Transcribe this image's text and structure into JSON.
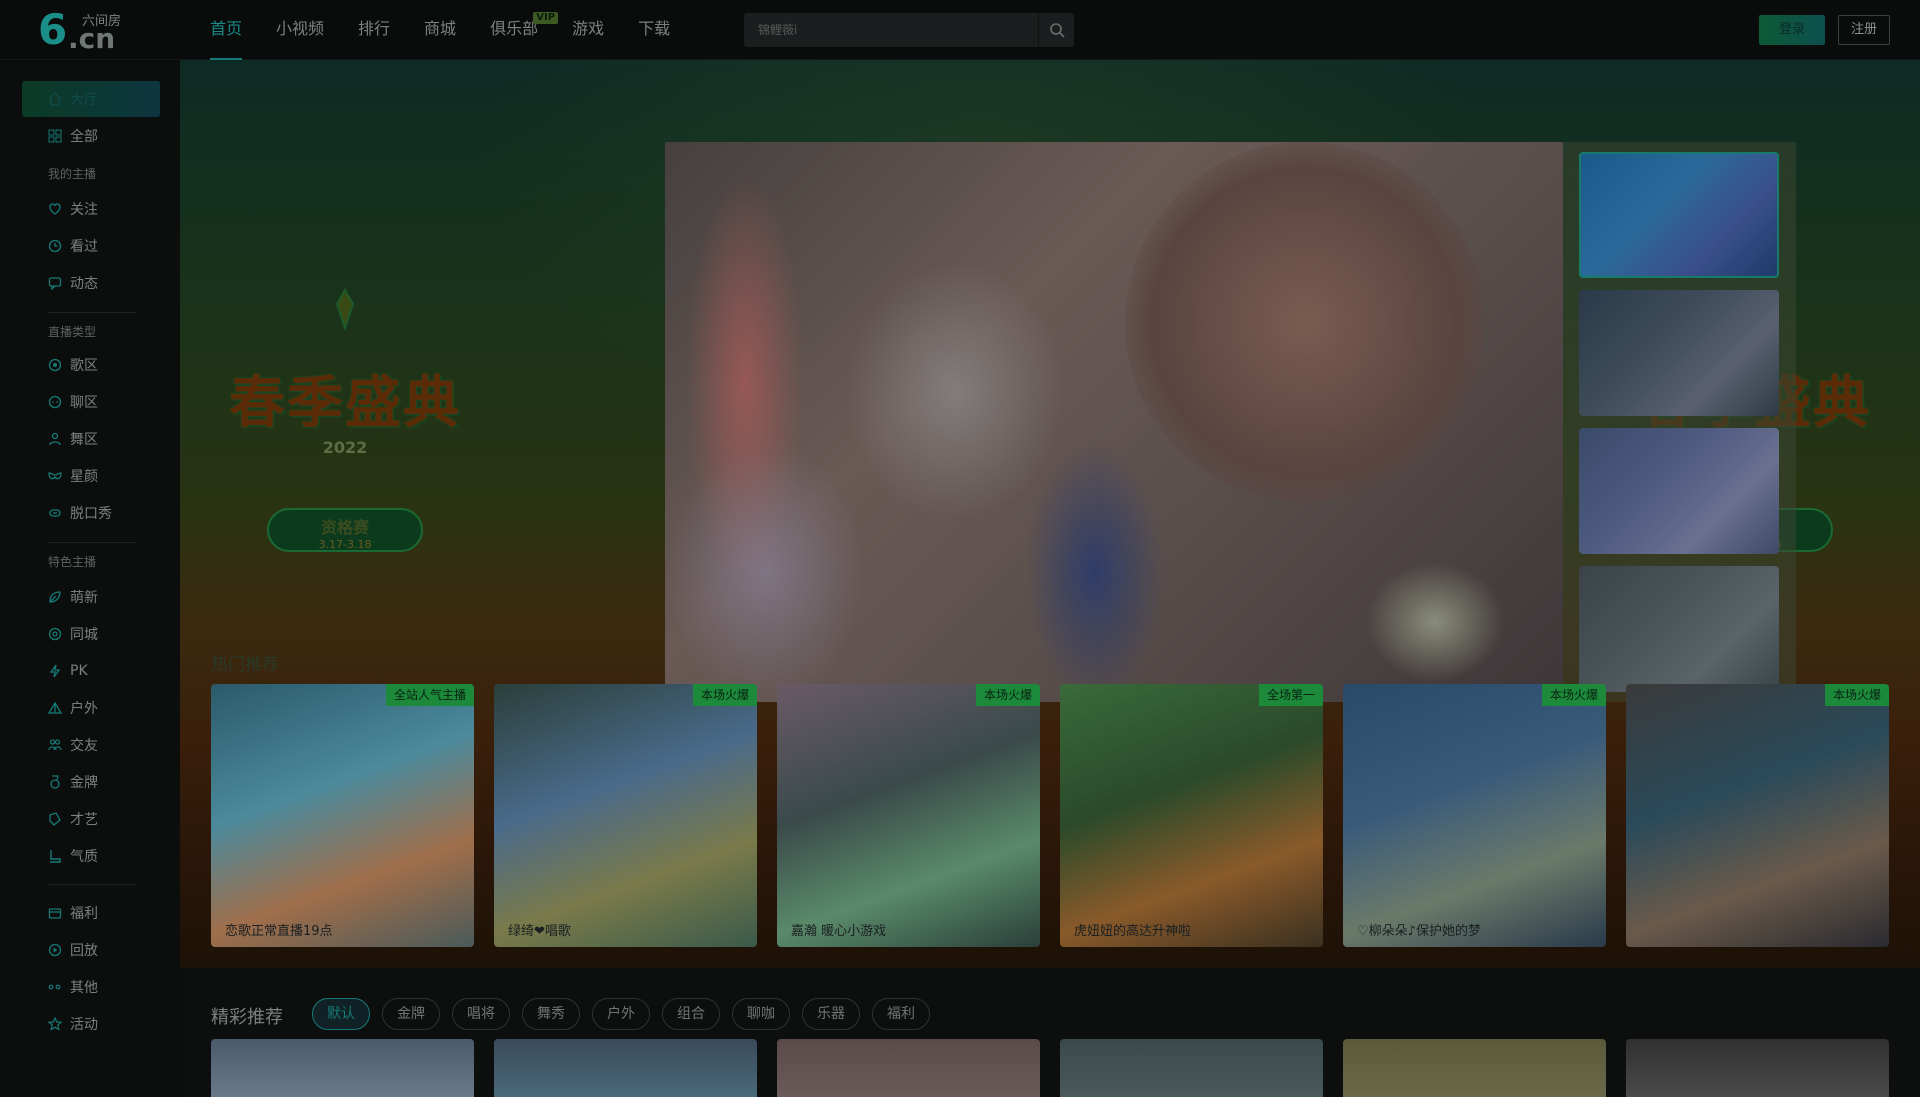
{
  "logo": {
    "mark": "6",
    "site_name": "六间房",
    "suffix": ".cn"
  },
  "nav": {
    "items": [
      {
        "label": "首页"
      },
      {
        "label": "小视频"
      },
      {
        "label": "排行"
      },
      {
        "label": "商城"
      },
      {
        "label": "俱乐部",
        "badge": "VIP"
      },
      {
        "label": "游戏"
      },
      {
        "label": "下载"
      }
    ],
    "active_index": 0
  },
  "search": {
    "placeholder": "锦鲤薇i"
  },
  "auth": {
    "login_label": "登录",
    "register_label": "注册"
  },
  "sidebar": {
    "main": [
      {
        "label": "大厅",
        "icon": "home-icon"
      },
      {
        "label": "全部",
        "icon": "grid-icon"
      }
    ],
    "group_my": "我的主播",
    "my": [
      {
        "label": "关注",
        "icon": "heart-icon"
      },
      {
        "label": "看过",
        "icon": "clock-icon"
      },
      {
        "label": "动态",
        "icon": "message-icon"
      }
    ],
    "group_type": "直播类型",
    "types": [
      {
        "label": "歌区",
        "icon": "music-icon"
      },
      {
        "label": "聊区",
        "icon": "chat-icon"
      },
      {
        "label": "舞区",
        "icon": "dance-icon"
      },
      {
        "label": "星颜",
        "icon": "mask-icon"
      },
      {
        "label": "脱口秀",
        "icon": "mic-icon"
      }
    ],
    "group_feature": "特色主播",
    "features": [
      {
        "label": "萌新",
        "icon": "leaf-icon"
      },
      {
        "label": "同城",
        "icon": "location-icon"
      },
      {
        "label": "PK",
        "icon": "bolt-icon"
      },
      {
        "label": "户外",
        "icon": "mountain-icon"
      },
      {
        "label": "交友",
        "icon": "people-icon"
      },
      {
        "label": "金牌",
        "icon": "medal-icon"
      },
      {
        "label": "才艺",
        "icon": "palette-icon"
      },
      {
        "label": "气质",
        "icon": "boot-icon"
      }
    ],
    "extras": [
      {
        "label": "福利",
        "icon": "gift-icon"
      },
      {
        "label": "回放",
        "icon": "replay-icon"
      },
      {
        "label": "其他",
        "icon": "dots-icon"
      },
      {
        "label": "活动",
        "icon": "star-icon"
      }
    ]
  },
  "event": {
    "title": "春季盛典",
    "year": "2022",
    "round": "资格赛",
    "dates": "3.17-3.18"
  },
  "hot_label": "热门推荐",
  "hot_cards": [
    {
      "tag": "全站人气主播",
      "caption": "恋歌正常直播19点"
    },
    {
      "tag": "本场火爆",
      "caption": "绿绮❤唱歌"
    },
    {
      "tag": "本场火爆",
      "caption": "嘉瀚 暖心小游戏"
    },
    {
      "tag": "全场第一",
      "caption": "虎妞妞的高达升神啦"
    },
    {
      "tag": "本场火爆",
      "caption": "♡柳朵朵♪保护她的梦"
    },
    {
      "tag": "本场火爆",
      "caption": ""
    }
  ],
  "recommend": {
    "title": "精彩推荐",
    "filters": [
      "默认",
      "金牌",
      "唱将",
      "舞秀",
      "户外",
      "组合",
      "聊咖",
      "乐器",
      "福利"
    ]
  },
  "colors": {
    "accent": "#157a76",
    "tag_bg": "#1c8a3a",
    "login_bg": "#0d5a35"
  }
}
